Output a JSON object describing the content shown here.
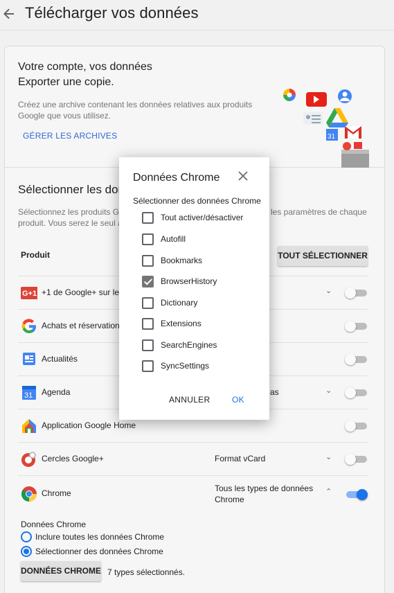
{
  "header": {
    "back_icon": "arrow-back-icon",
    "title": "Télécharger vos données"
  },
  "intro": {
    "line1": "Votre compte, vos données",
    "line2": "Exporter une copie.",
    "desc1": "Créez une archive contenant les données relatives aux produits",
    "desc2": "Google que vous utilisez.",
    "manage_link": "GÉRER LES ARCHIVES"
  },
  "select": {
    "title": "Sélectionner les don",
    "desc1_left": "Sélectionnez les produits Go",
    "desc1_right": "les paramètres de chaque",
    "desc2": "produit. Vous serez le seul à",
    "product_header": "Produit",
    "select_all": "TOUT SÉLECTIONNER"
  },
  "products": [
    {
      "name": "+1 de Google+ sur les",
      "format": "",
      "icon": "google-plus-one-icon",
      "has_chevron": true,
      "enabled": false
    },
    {
      "name": "Achats et réservations",
      "format": "",
      "icon": "google-g-icon",
      "has_chevron": false,
      "enabled": false
    },
    {
      "name": "Actualités",
      "format": "",
      "icon": "google-news-icon",
      "has_chevron": false,
      "enabled": false
    },
    {
      "name": "Agenda",
      "format": "as",
      "icon": "calendar-icon",
      "has_chevron": true,
      "enabled": false
    },
    {
      "name": "Application Google Home",
      "format": "",
      "icon": "google-home-icon",
      "has_chevron": false,
      "enabled": false
    },
    {
      "name": "Cercles Google+",
      "format": "Format vCard",
      "icon": "google-circles-icon",
      "has_chevron": true,
      "enabled": false
    },
    {
      "name": "Chrome",
      "format_line1": "Tous les types de données",
      "format_line2": "Chrome",
      "icon": "chrome-icon",
      "has_chevron": true,
      "enabled": true
    }
  ],
  "chrome_options": {
    "label": "Données Chrome",
    "radio_all": "Inclure toutes les données Chrome",
    "radio_select": "Sélectionner des données Chrome",
    "button": "DONNÉES CHROME",
    "count_text": "7 types sélectionnés."
  },
  "dialog": {
    "title": "Données Chrome",
    "close_icon": "close-icon",
    "subtitle": "Sélectionner des données Chrome",
    "items": [
      {
        "label": "Tout activer/désactiver",
        "checked": false
      },
      {
        "label": "Autofill",
        "checked": false
      },
      {
        "label": "Bookmarks",
        "checked": false
      },
      {
        "label": "BrowserHistory",
        "checked": true
      },
      {
        "label": "Dictionary",
        "checked": false
      },
      {
        "label": "Extensions",
        "checked": false
      },
      {
        "label": "SearchEngines",
        "checked": false
      },
      {
        "label": "SyncSettings",
        "checked": false
      }
    ],
    "cancel": "ANNULER",
    "ok": "OK"
  },
  "colors": {
    "accent": "#1a73e8",
    "link": "#3367d6"
  }
}
